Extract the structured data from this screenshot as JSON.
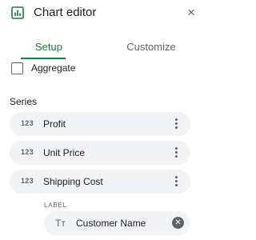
{
  "header": {
    "title": "Chart editor",
    "chart_icon": "chart-icon",
    "close_glyph": "×",
    "accent_color": "#188038"
  },
  "tabs": [
    {
      "label": "Setup",
      "active": true
    },
    {
      "label": "Customize",
      "active": false
    }
  ],
  "aggregate": {
    "label": "Aggregate",
    "checked": false
  },
  "series": {
    "heading": "Series",
    "items": [
      {
        "type": "123",
        "name": "Profit"
      },
      {
        "type": "123",
        "name": "Unit Price"
      },
      {
        "type": "123",
        "name": "Shipping Cost"
      }
    ],
    "label": {
      "caption": "LABEL",
      "type": "Tт",
      "name": "Customer Name"
    }
  }
}
